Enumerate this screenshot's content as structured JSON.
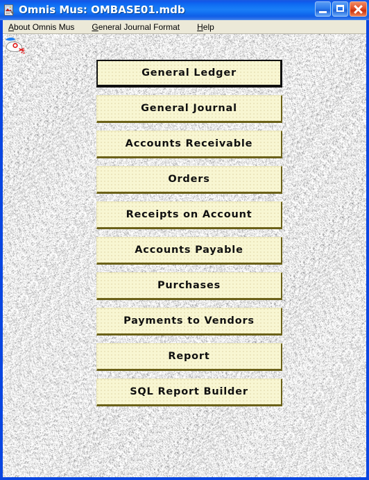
{
  "window": {
    "title": "Omnis Mus: OMBASE01.mdb",
    "title_icon": "document-image-icon",
    "controls": {
      "minimize_label": "Minimize",
      "maximize_label": "Maximize",
      "close_label": "Close"
    }
  },
  "menu_bar": {
    "items": [
      {
        "label": "About Omnis Mus",
        "accel": "A",
        "name": "menu-about-omnis-mus"
      },
      {
        "label": "General Journal Format",
        "accel": "G",
        "name": "menu-general-journal-format"
      },
      {
        "label": "Help",
        "accel": "H",
        "name": "menu-help"
      }
    ]
  },
  "client": {
    "logo_icon": "mouse-logo-icon",
    "background": "gray-noise-texture"
  },
  "buttons": [
    {
      "label": "General Ledger",
      "name": "button-general-ledger",
      "focused": true
    },
    {
      "label": "General Journal",
      "name": "button-general-journal",
      "focused": false
    },
    {
      "label": "Accounts Receivable",
      "name": "button-accounts-receivable",
      "focused": false
    },
    {
      "label": "Orders",
      "name": "button-orders",
      "focused": false
    },
    {
      "label": "Receipts on Account",
      "name": "button-receipts-on-account",
      "focused": false
    },
    {
      "label": "Accounts Payable",
      "name": "button-accounts-payable",
      "focused": false
    },
    {
      "label": "Purchases",
      "name": "button-purchases",
      "focused": false
    },
    {
      "label": "Payments to Vendors",
      "name": "button-payments-to-vendors",
      "focused": false
    },
    {
      "label": "Report",
      "name": "button-report",
      "focused": false
    },
    {
      "label": "SQL Report Builder",
      "name": "button-sql-report-builder",
      "focused": false
    }
  ],
  "colors": {
    "title_bar_blue": "#0e63ef",
    "window_frame_blue": "#0a46e0",
    "menu_bar_bg": "#ece9d8",
    "button_face": "#f8f6d2",
    "button_shadow": "#6b6118",
    "client_bg": "#cfcfcf",
    "close_button_red": "#e4512a"
  }
}
